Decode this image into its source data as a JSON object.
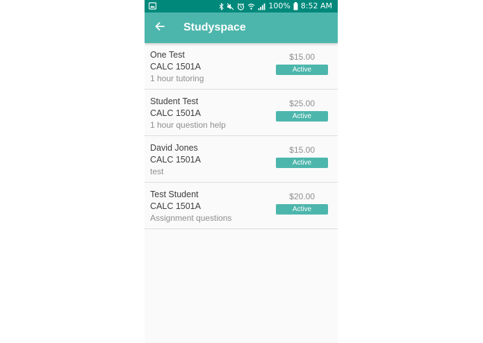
{
  "status_bar": {
    "battery": "100%",
    "time": "8:52 AM",
    "icons": [
      "image-icon",
      "bluetooth-icon",
      "mute-icon",
      "alarm-icon",
      "wifi-icon",
      "signal-icon",
      "battery-icon"
    ]
  },
  "app_bar": {
    "title": "Studyspace",
    "back_icon": "arrow-left-icon"
  },
  "colors": {
    "status_bar": "#00897b",
    "app_bar": "#4db6ac",
    "badge": "#4db6ac"
  },
  "sessions": [
    {
      "name": "One Test",
      "course": "CALC 1501A",
      "description": "1 hour tutoring",
      "price": "$15.00",
      "status": "Active"
    },
    {
      "name": "Student Test",
      "course": "CALC 1501A",
      "description": "1 hour question help",
      "price": "$25.00",
      "status": "Active"
    },
    {
      "name": "David Jones",
      "course": "CALC 1501A",
      "description": "test",
      "price": "$15.00",
      "status": "Active"
    },
    {
      "name": "Test Student",
      "course": "CALC 1501A",
      "description": "Assignment questions",
      "price": "$20.00",
      "status": "Active"
    }
  ]
}
